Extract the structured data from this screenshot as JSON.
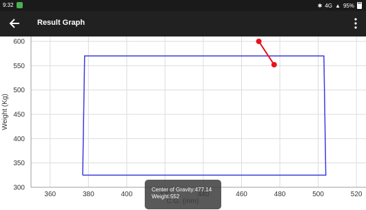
{
  "status_bar": {
    "time": "9:32",
    "network": "4G",
    "battery": "95%"
  },
  "app_bar": {
    "title": "Result Graph"
  },
  "chart_data": {
    "type": "line",
    "xlabel": "C.G. (mm)",
    "ylabel": "Weight (Kg)",
    "xlim": [
      350,
      525
    ],
    "ylim": [
      300,
      610
    ],
    "x_ticks": [
      360,
      380,
      400,
      420,
      440,
      460,
      480,
      500,
      520
    ],
    "y_ticks": [
      300,
      350,
      400,
      450,
      500,
      550,
      600
    ],
    "grid": true,
    "series": [
      {
        "color": "#3a3adf",
        "points": [
          [
            377,
            325
          ],
          [
            378,
            570
          ],
          [
            503,
            570
          ],
          [
            504,
            325
          ],
          [
            377,
            325
          ]
        ]
      },
      {
        "color": "#e8111c",
        "points": [
          [
            469,
            600
          ],
          [
            477,
            552
          ]
        ]
      }
    ],
    "tooltip": {
      "line1": "Center of Gravity:477.14",
      "line2": "Weight:552"
    }
  }
}
